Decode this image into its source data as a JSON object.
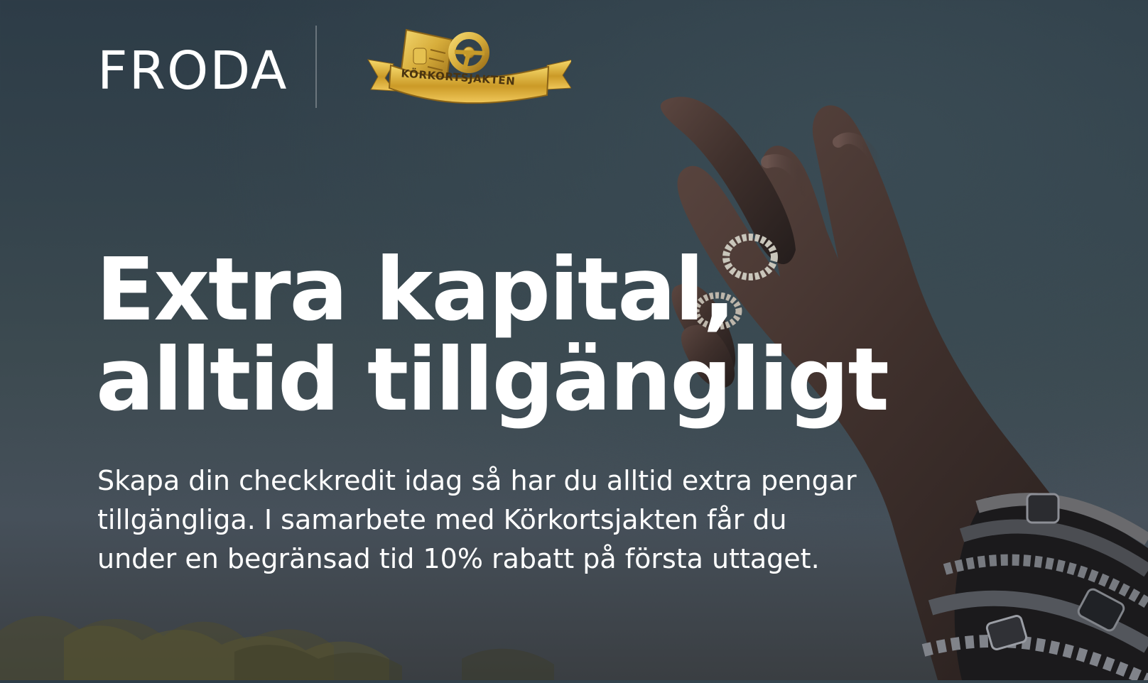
{
  "brand": {
    "name": "FRODA",
    "partner_name": "KÖRKORTSJAKTEN",
    "icon": "driving-license-steering-wheel-icon"
  },
  "hero": {
    "headline_line1": "Extra kapital,",
    "headline_line2": "alltid tillgängligt",
    "description": "Skapa din checkkredit idag så har du alltid extra pengar tillgängliga. I samarbete med Körkortsjakten får du under en begränsad tid 10% rabatt på första uttaget."
  },
  "colors": {
    "sky_top": "#2d3c47",
    "sky_bottom": "#46505a",
    "text": "#ffffff",
    "gold": "#d7ad3b",
    "gold_dark": "#a97b1f"
  }
}
